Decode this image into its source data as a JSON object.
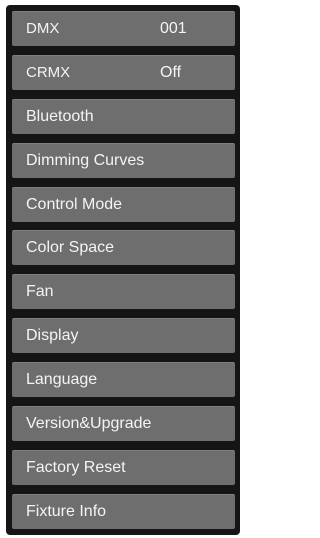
{
  "menu": {
    "items": [
      {
        "label": "DMX",
        "value": "001"
      },
      {
        "label": "CRMX",
        "value": "Off"
      },
      {
        "label": "Bluetooth"
      },
      {
        "label": "Dimming Curves"
      },
      {
        "label": "Control Mode"
      },
      {
        "label": "Color Space"
      },
      {
        "label": "Fan"
      },
      {
        "label": "Display"
      },
      {
        "label": "Language"
      },
      {
        "label": "Version&Upgrade"
      },
      {
        "label": "Factory Reset"
      },
      {
        "label": "Fixture Info"
      }
    ]
  }
}
